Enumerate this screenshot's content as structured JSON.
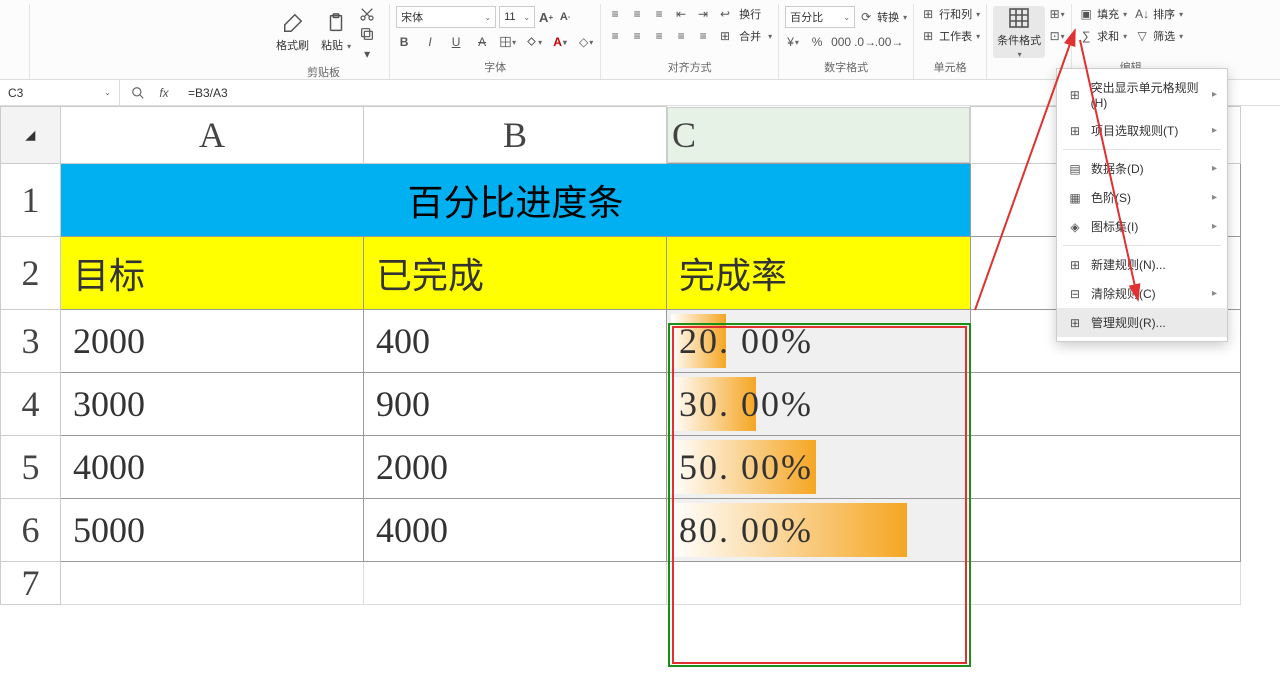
{
  "ribbon": {
    "clipboard": {
      "label": "剪贴板",
      "format_painter": "格式刷",
      "paste": "粘贴"
    },
    "font": {
      "label": "字体",
      "name": "宋体",
      "size": "11",
      "inc": "A+",
      "dec": "A-",
      "bold": "B",
      "italic": "I",
      "underline": "U"
    },
    "align": {
      "label": "对齐方式",
      "wrap": "换行",
      "merge": "合并"
    },
    "number": {
      "label": "数字格式",
      "format": "百分比",
      "convert": "转换"
    },
    "cells": {
      "label": "单元格",
      "rowcol": "行和列",
      "sheet": "工作表",
      "cond_format": "条件格式"
    },
    "editing": {
      "label": "编辑",
      "fill": "填充",
      "sort": "排序",
      "sum": "求和",
      "filter": "筛选"
    }
  },
  "formula_bar": {
    "ref": "C3",
    "formula": "=B3/A3"
  },
  "columns": [
    "A",
    "B",
    "C"
  ],
  "rows": [
    "1",
    "2",
    "3",
    "4",
    "5",
    "6",
    "7"
  ],
  "table": {
    "title": "百分比进度条",
    "headers": [
      "目标",
      "已完成",
      "完成率"
    ],
    "data": [
      {
        "a": "2000",
        "b": "400",
        "c": "20. 00%",
        "pct": 20
      },
      {
        "a": "3000",
        "b": "900",
        "c": "30. 00%",
        "pct": 30
      },
      {
        "a": "4000",
        "b": "2000",
        "c": "50. 00%",
        "pct": 50
      },
      {
        "a": "5000",
        "b": "4000",
        "c": "80. 00%",
        "pct": 80
      }
    ]
  },
  "menu": {
    "items": [
      {
        "label": "突出显示单元格规则(H)",
        "arrow": true
      },
      {
        "label": "项目选取规则(T)",
        "arrow": true
      },
      {
        "sep": true
      },
      {
        "label": "数据条(D)",
        "arrow": true
      },
      {
        "label": "色阶(S)",
        "arrow": true
      },
      {
        "label": "图标集(I)",
        "arrow": true
      },
      {
        "sep": true
      },
      {
        "label": "新建规则(N)...",
        "arrow": false
      },
      {
        "label": "清除规则(C)",
        "arrow": true
      },
      {
        "label": "管理规则(R)...",
        "arrow": false,
        "hov": true
      }
    ]
  }
}
